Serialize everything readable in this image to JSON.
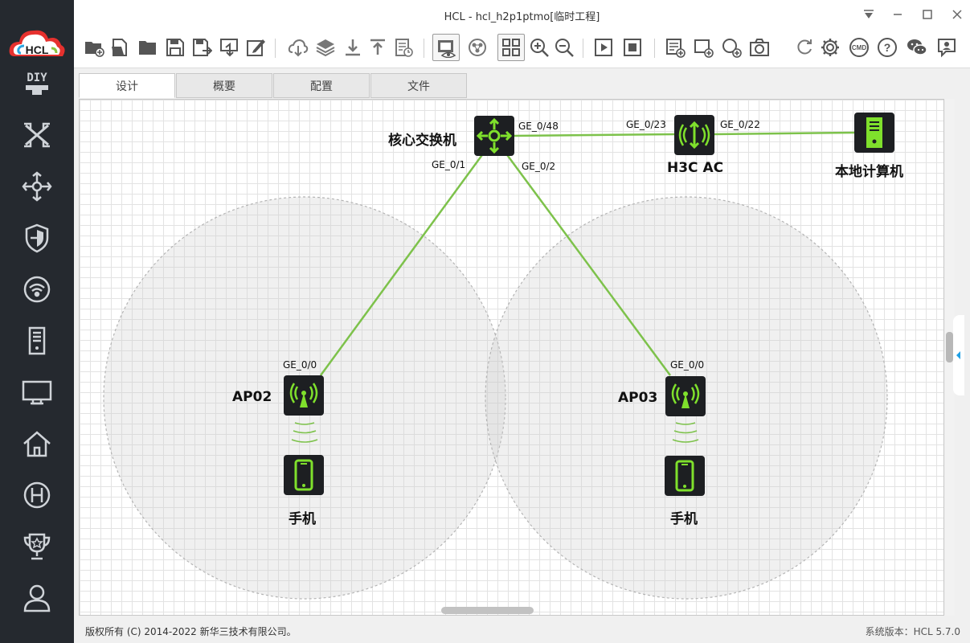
{
  "window": {
    "title": "HCL - hcl_h2p1ptmo[临时工程]"
  },
  "logo": {
    "text": "HCL"
  },
  "sidebar": {
    "items": [
      {
        "icon": "diy-icon"
      },
      {
        "icon": "network-topology-icon"
      },
      {
        "icon": "router-icon"
      },
      {
        "icon": "firewall-icon"
      },
      {
        "icon": "wireless-icon"
      },
      {
        "icon": "server-icon"
      },
      {
        "icon": "monitor-icon"
      },
      {
        "icon": "home-icon"
      },
      {
        "icon": "h3c-icon"
      },
      {
        "icon": "trophy-icon"
      },
      {
        "icon": "user-icon"
      }
    ]
  },
  "tabs": [
    {
      "label": "设计",
      "active": true
    },
    {
      "label": "概要"
    },
    {
      "label": "配置"
    },
    {
      "label": "文件"
    }
  ],
  "topology": {
    "devices": {
      "core_switch": "核心交换机",
      "ac": "H3C AC",
      "pc": "本地计算机",
      "ap02": "AP02",
      "ap03": "AP03",
      "phone1": "手机",
      "phone2": "手机"
    },
    "ports": {
      "core_ge048": "GE_0/48",
      "ac_ge023": "GE_0/23",
      "ac_ge022": "GE_0/22",
      "core_ge01": "GE_0/1",
      "core_ge02": "GE_0/2",
      "ap02_ge00": "GE_0/0",
      "ap03_ge00": "GE_0/0"
    }
  },
  "status": {
    "copyright": "版权所有 (C) 2014-2022 新华三技术有限公司。",
    "version": "系统版本：HCL 5.7.0"
  },
  "colors": {
    "link": "#7dc24b",
    "device_green": "#7fe02c",
    "sidebar_bg": "#25292f"
  }
}
